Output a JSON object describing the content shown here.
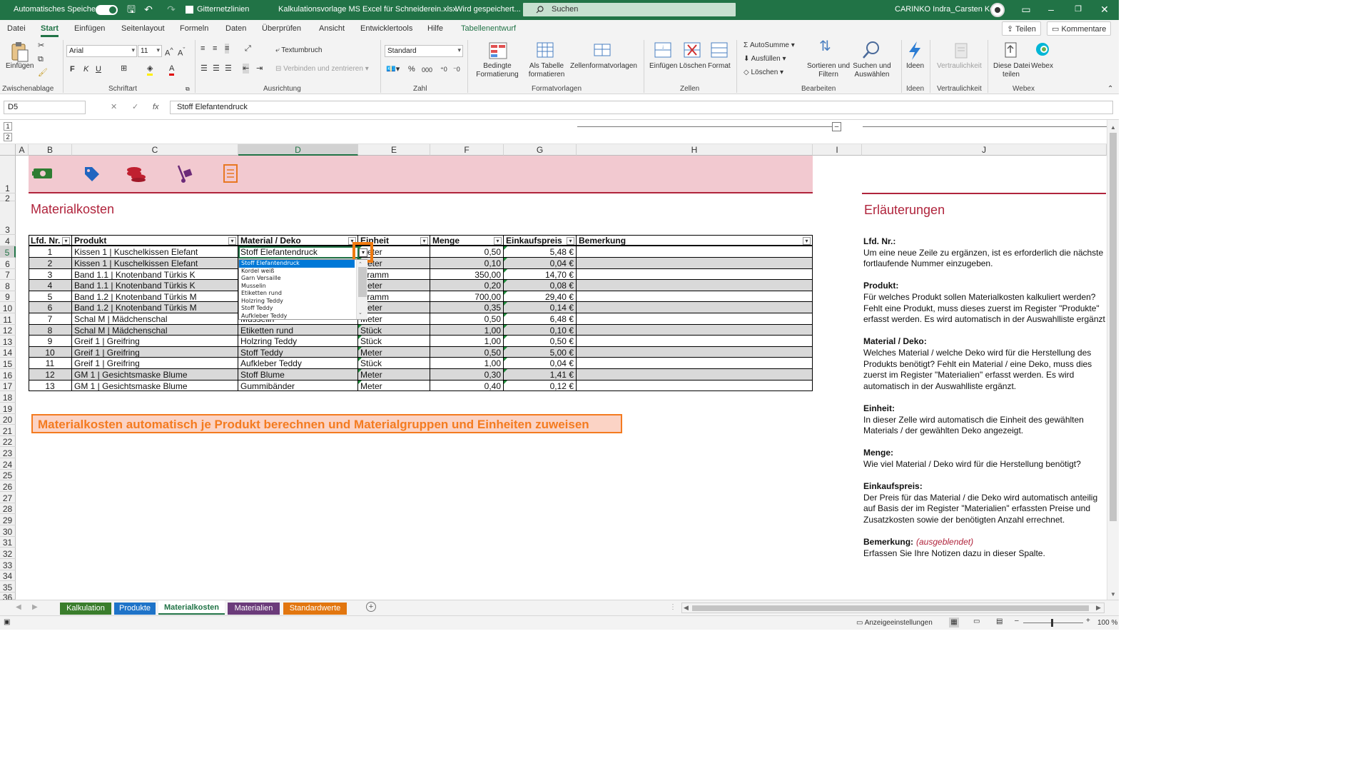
{
  "titlebar": {
    "autosave_label": "Automatisches Speichern",
    "gridlines_label": "Gitternetzlinien",
    "filename": "Kalkulationsvorlage MS Excel für Schneiderein.xlsx",
    "save_status": "Wird gespeichert...",
    "search_placeholder": "Suchen",
    "user_name": "CARINKO Indra_Carsten Kohl"
  },
  "menu": {
    "tabs": [
      "Datei",
      "Start",
      "Einfügen",
      "Seitenlayout",
      "Formeln",
      "Daten",
      "Überprüfen",
      "Ansicht",
      "Entwicklertools",
      "Hilfe",
      "Tabellenentwurf"
    ],
    "share_label": "Teilen",
    "comments_label": "Kommentare"
  },
  "ribbon": {
    "clipboard": {
      "paste": "Einfügen",
      "group": "Zwischenablage"
    },
    "font": {
      "name": "Arial",
      "size": "11",
      "bold": "F",
      "italic": "K",
      "underline": "U",
      "group": "Schriftart"
    },
    "alignment": {
      "wrap": "Textumbruch",
      "merge": "Verbinden und zentrieren",
      "group": "Ausrichtung"
    },
    "number": {
      "format": "Standard",
      "group": "Zahl"
    },
    "styles": {
      "conditional": "Bedingte\nFormatierung",
      "as_table": "Als Tabelle\nformatieren",
      "cell_styles": "Zellenformatvorlagen",
      "group": "Formatvorlagen"
    },
    "cells": {
      "insert": "Einfügen",
      "delete": "Löschen",
      "format": "Format",
      "group": "Zellen"
    },
    "editing": {
      "autosum": "AutoSumme",
      "fill": "Ausfüllen",
      "clear": "Löschen",
      "sort": "Sortieren und\nFiltern",
      "find": "Suchen und\nAuswählen",
      "group": "Bearbeiten"
    },
    "ideas": {
      "label": "Ideen",
      "group": "Ideen"
    },
    "sensitivity": {
      "label": "Vertraulichkeit",
      "group": "Vertraulichkeit"
    },
    "webex": {
      "share": "Diese Datei\nteilen",
      "webex": "Webex",
      "group": "Webex"
    }
  },
  "formula_bar": {
    "name_box": "D5",
    "formula": "Stoff Elefantendruck"
  },
  "columns": [
    "A",
    "B",
    "C",
    "D",
    "E",
    "F",
    "G",
    "H",
    "I",
    "J"
  ],
  "rows": [
    "1",
    "2",
    "3",
    "4",
    "5",
    "6",
    "7",
    "8",
    "9",
    "10",
    "11",
    "12",
    "13",
    "14",
    "15",
    "16",
    "17",
    "18",
    "19",
    "20",
    "21",
    "22",
    "23",
    "24",
    "25",
    "26",
    "27",
    "28",
    "29",
    "30",
    "31",
    "32",
    "33",
    "34",
    "35",
    "36"
  ],
  "sheet": {
    "title": "Materialkosten",
    "table_headers": [
      "Lfd. Nr.",
      "Produkt",
      "Material / Deko",
      "Einheit",
      "Menge",
      "Einkaufspreis",
      "Bemerkung"
    ],
    "table_rows": [
      [
        "1",
        "Kissen 1 | Kuschelkissen Elefant",
        "Stoff Elefantendruck",
        "Meter",
        "0,50",
        "5,48 €",
        ""
      ],
      [
        "2",
        "Kissen 1 | Kuschelkissen Elefant",
        "",
        "Meter",
        "0,10",
        "0,04 €",
        ""
      ],
      [
        "3",
        "Band 1.1 | Knotenband Türkis K",
        "",
        "Gramm",
        "350,00",
        "14,70 €",
        ""
      ],
      [
        "4",
        "Band 1.1 | Knotenband Türkis K",
        "",
        "Meter",
        "0,20",
        "0,08 €",
        ""
      ],
      [
        "5",
        "Band 1.2 | Knotenband Türkis M",
        "",
        "Gramm",
        "700,00",
        "29,40 €",
        ""
      ],
      [
        "6",
        "Band 1.2 | Knotenband Türkis M",
        "",
        "Meter",
        "0,35",
        "0,14 €",
        ""
      ],
      [
        "7",
        "Schal M | Mädchenschal",
        "Musselin",
        "Meter",
        "0,50",
        "6,48 €",
        ""
      ],
      [
        "8",
        "Schal M | Mädchenschal",
        "Etiketten rund",
        "Stück",
        "1,00",
        "0,10 €",
        ""
      ],
      [
        "9",
        "Greif 1 | Greifring",
        "Holzring Teddy",
        "Stück",
        "1,00",
        "0,50 €",
        ""
      ],
      [
        "10",
        "Greif 1 | Greifring",
        "Stoff Teddy",
        "Meter",
        "0,50",
        "5,00 €",
        ""
      ],
      [
        "11",
        "Greif 1 | Greifring",
        "Aufkleber Teddy",
        "Stück",
        "1,00",
        "0,04 €",
        ""
      ],
      [
        "12",
        "GM 1 | Gesichtsmaske Blume",
        "Stoff Blume",
        "Meter",
        "0,30",
        "1,41 €",
        ""
      ],
      [
        "13",
        "GM 1 | Gesichtsmaske Blume",
        "Gummibänder",
        "Meter",
        "0,40",
        "0,12 €",
        ""
      ]
    ],
    "dropdown_options": [
      "Stoff Elefantendruck",
      "Kordel weiß",
      "Garn Versaille",
      "Musselin",
      "Etiketten rund",
      "Holzring Teddy",
      "Stoff Teddy",
      "Aufkleber Teddy"
    ],
    "banner": "Materialkosten automatisch je Produkt berechnen und Materialgruppen und Einheiten zuweisen",
    "colors": {
      "header_band": "#f2c9d0",
      "accent_red": "#b0243c",
      "banner_orange": "#f47b20",
      "banner_bg": "#fbd3c5"
    }
  },
  "notes": {
    "title": "Erläuterungen",
    "sections": [
      {
        "heading": "Lfd. Nr.:",
        "lines": [
          "Um eine neue Zeile zu ergänzen, ist es erforderlich die nächste",
          "fortlaufende Nummer einzugeben."
        ]
      },
      {
        "heading": "Produkt:",
        "lines": [
          "Für welches Produkt sollen Materialkosten kalkuliert werden?",
          "Fehlt eine Produkt, muss dieses zuerst im Register \"Produkte\"",
          "erfasst werden. Es wird automatisch in der Auswahlliste ergänzt."
        ]
      },
      {
        "heading": "Material / Deko:",
        "lines": [
          "Welches Material / welche Deko wird für die Herstellung des",
          "Produkts benötigt? Fehlt ein Material / eine Deko, muss dies",
          "zuerst im Register \"Materialien\" erfasst werden. Es wird",
          "automatisch in der Auswahlliste ergänzt."
        ]
      },
      {
        "heading": "Einheit:",
        "lines": [
          "In dieser Zelle wird automatisch die Einheit des gewählten",
          "Materials / der gewählten Deko angezeigt."
        ]
      },
      {
        "heading": "Menge:",
        "lines": [
          "Wie viel Material / Deko wird für die Herstellung benötigt?"
        ]
      },
      {
        "heading": "Einkaufspreis:",
        "lines": [
          "Der Preis für das Material / die Deko wird automatisch anteilig",
          "auf Basis der im Register \"Materialien\" erfassten Preise und",
          "Zusatzkosten sowie der benötigten Anzahl errechnet."
        ]
      },
      {
        "heading": "Bemerkung:",
        "extra": "(ausgeblendet)",
        "lines": [
          "Erfassen Sie Ihre Notizen dazu in dieser Spalte."
        ]
      }
    ]
  },
  "sheet_tabs": [
    {
      "label": "Kalkulation",
      "color": "#3a7d2c"
    },
    {
      "label": "Produkte",
      "color": "#1e73c8"
    },
    {
      "label": "Materialkosten",
      "color": "#ffffff"
    },
    {
      "label": "Materialien",
      "color": "#6b3b7a"
    },
    {
      "label": "Standardwerte",
      "color": "#e2760f"
    }
  ],
  "status": {
    "display_settings": "Anzeigeeinstellungen",
    "zoom": "100 %"
  }
}
